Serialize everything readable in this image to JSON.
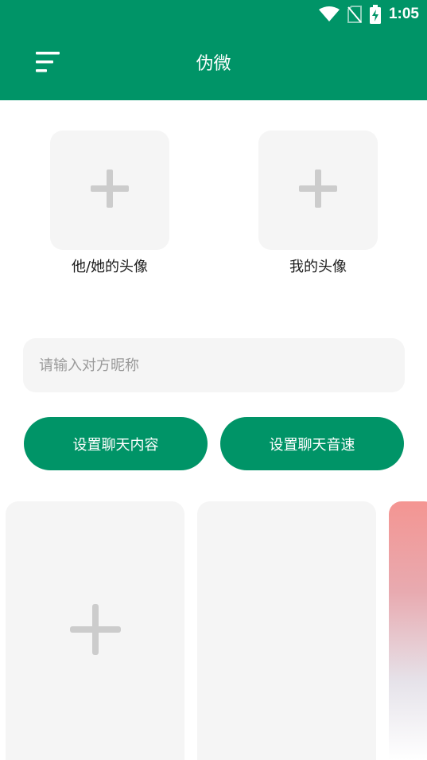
{
  "status_bar": {
    "time": "1:05"
  },
  "header": {
    "title": "伪微"
  },
  "avatars": [
    {
      "label": "他/她的头像"
    },
    {
      "label": "我的头像"
    }
  ],
  "nickname": {
    "placeholder": "请输入对方昵称",
    "value": ""
  },
  "buttons": {
    "chat_content": "设置聊天内容",
    "chat_speed": "设置聊天音速"
  },
  "colors": {
    "primary": "#009467",
    "surface": "#f5f5f5",
    "plus": "#cccccc"
  }
}
